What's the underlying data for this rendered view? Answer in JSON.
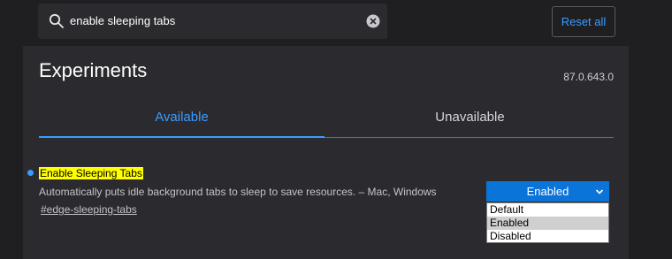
{
  "search": {
    "value": "enable sleeping tabs"
  },
  "header": {
    "reset_label": "Reset all"
  },
  "page": {
    "title": "Experiments",
    "version": "87.0.643.0"
  },
  "tabs": [
    {
      "label": "Available",
      "active": true
    },
    {
      "label": "Unavailable",
      "active": false
    }
  ],
  "flag": {
    "title": "Enable Sleeping Tabs",
    "description": "Automatically puts idle background tabs to sleep to save resources. – Mac, Windows",
    "link": "#edge-sleeping-tabs",
    "selected_value": "Enabled",
    "options": [
      "Default",
      "Enabled",
      "Disabled"
    ]
  },
  "colors": {
    "accent": "#3b9cff",
    "highlight": "#ffff00",
    "select_bg": "#0a74d9",
    "panel_bg": "#2b2b2f",
    "page_bg": "#1f1f22"
  },
  "icons": {
    "search": "search-icon",
    "clear": "clear-icon",
    "chevron": "chevron-down-icon"
  }
}
